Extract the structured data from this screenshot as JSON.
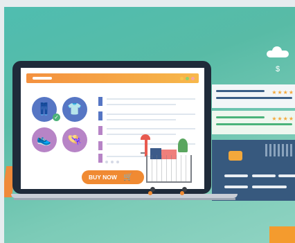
{
  "colors": {
    "background": "#58bba6",
    "accent_orange": "#f08a32",
    "laptop_body": "#1f2b3a",
    "card_navy": "#37597e",
    "product_blue": "#5676c4",
    "product_purple": "#b784c6"
  },
  "header": {
    "window_dots": [
      "#f7c64b",
      "#8fd16d",
      "#f7a4a4"
    ]
  },
  "products": [
    {
      "icon": "pants-icon",
      "glyph": "👖",
      "color": "blue"
    },
    {
      "icon": "tshirt-icon",
      "glyph": "👕",
      "color": "blue"
    },
    {
      "icon": "shoe-icon",
      "glyph": "👟",
      "color": "purple"
    },
    {
      "icon": "hat-icon",
      "glyph": "👒",
      "color": "purple"
    }
  ],
  "checkmark": "✓",
  "list_markers": [
    "#5676c4",
    "#5676c4",
    "#b784c6",
    "#b784c6",
    "#b784c6"
  ],
  "cta": {
    "label": "BUY NOW",
    "icon": "cart-icon",
    "glyph": "🛒"
  },
  "rating": {
    "stars": "★★★★"
  },
  "price_symbol": "$",
  "cart_items": [
    "umbrella-icon",
    "bag-icon",
    "plant-icon",
    "gift-icon"
  ]
}
